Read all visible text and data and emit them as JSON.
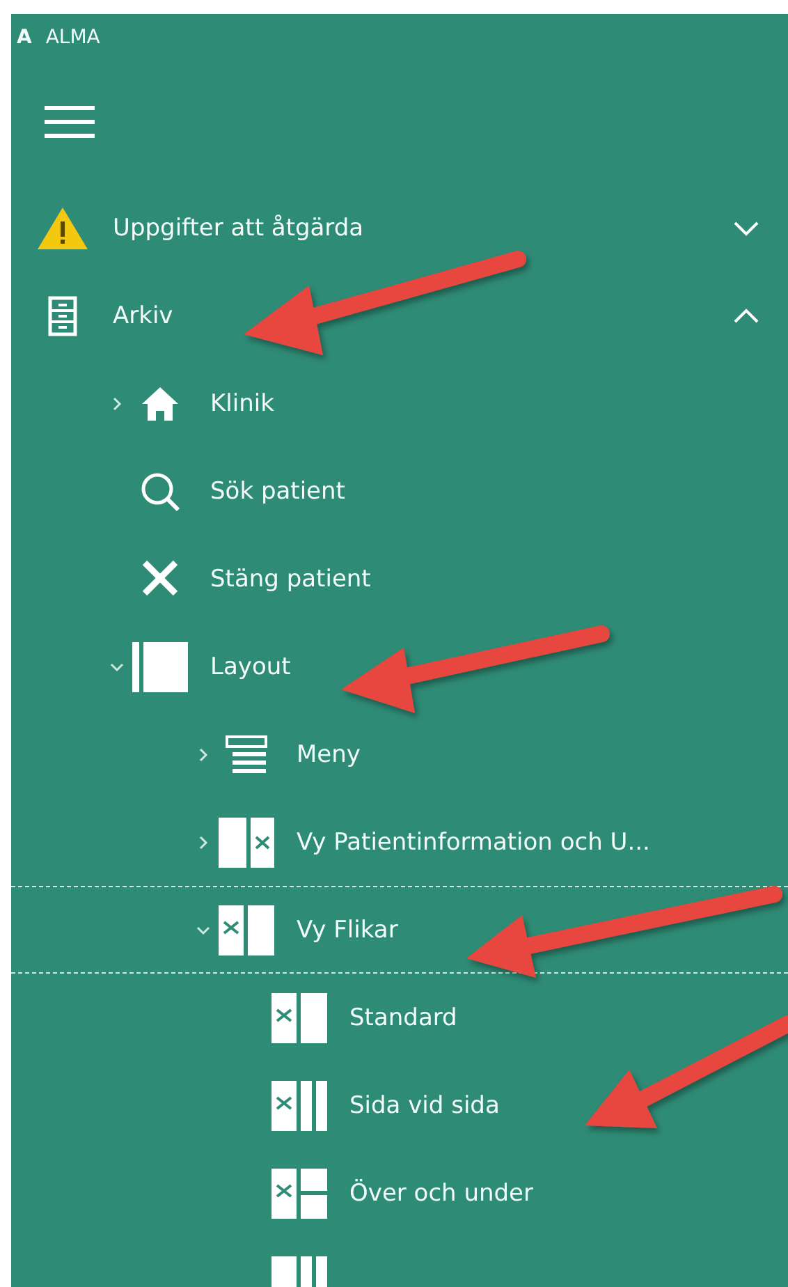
{
  "app": {
    "logo": "A",
    "title": "ALMA"
  },
  "menu": {
    "items": [
      {
        "label": "Uppgifter att åtgärda",
        "kind": "warning",
        "expanded": false,
        "selected": false
      },
      {
        "label": "Arkiv",
        "kind": "archive",
        "expanded": true,
        "selected": false,
        "children": [
          {
            "label": "Klinik",
            "kind": "home",
            "expanded": false,
            "selected": false
          },
          {
            "label": "Sök patient",
            "kind": "search",
            "selected": false
          },
          {
            "label": "Stäng patient",
            "kind": "close",
            "selected": false
          },
          {
            "label": "Layout",
            "kind": "layout",
            "expanded": true,
            "selected": false,
            "children": [
              {
                "label": "Meny",
                "kind": "lines",
                "expanded": false,
                "selected": false
              },
              {
                "label": "Vy Patientinformation och U...",
                "kind": "pane-right-x",
                "expanded": false,
                "selected": false
              },
              {
                "label": "Vy Flikar",
                "kind": "pane-left-x",
                "expanded": true,
                "selected": true,
                "children": [
                  {
                    "label": "Standard",
                    "kind": "pane-left-x",
                    "selected": false
                  },
                  {
                    "label": "Sida vid sida",
                    "kind": "three-col-x",
                    "selected": false
                  },
                  {
                    "label": "Över och under",
                    "kind": "split-x",
                    "selected": false
                  },
                  {
                    "kind": "three-col",
                    "selected": false
                  }
                ]
              }
            ]
          }
        ]
      }
    ]
  }
}
